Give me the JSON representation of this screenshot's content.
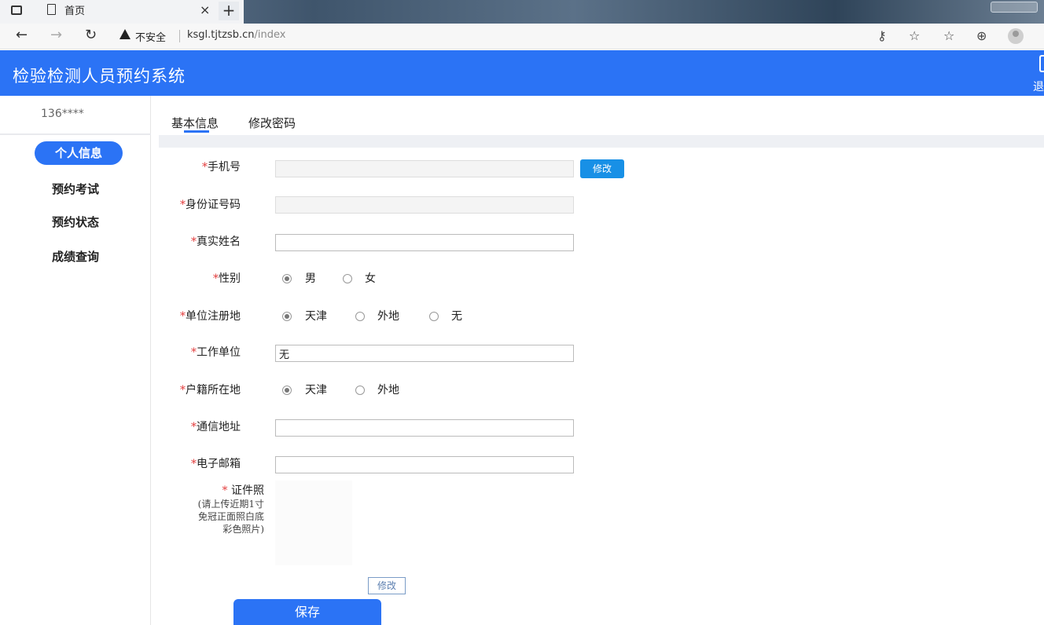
{
  "browser": {
    "tab_title": "首页",
    "tab_close": "×",
    "new_tab": "+",
    "insecure_label": "不安全",
    "url_host": "ksgl.tjtzsb.cn",
    "url_path": "/index"
  },
  "app": {
    "title": "检验检测人员预约系统",
    "header_edge_text": "退"
  },
  "sidebar": {
    "user": "136****",
    "items": [
      {
        "label": "个人信息",
        "active": true
      },
      {
        "label": "预约考试"
      },
      {
        "label": "预约状态"
      },
      {
        "label": "成绩查询"
      }
    ]
  },
  "tabs": [
    {
      "label": "基本信息",
      "active": true
    },
    {
      "label": "修改密码"
    }
  ],
  "form": {
    "required_mark": "*",
    "phone": {
      "label": "手机号",
      "value": "",
      "modify_button": "修改"
    },
    "id_number": {
      "label": "身份证号码",
      "value": ""
    },
    "real_name": {
      "label": "真实姓名",
      "value": ""
    },
    "gender": {
      "label": "性别",
      "options": [
        "男",
        "女"
      ],
      "selected": "男"
    },
    "unit_region": {
      "label": "单位注册地",
      "options": [
        "天津",
        "外地",
        "无"
      ],
      "selected": "天津"
    },
    "work_unit": {
      "label": "工作单位",
      "value": "无"
    },
    "household": {
      "label": "户籍所在地",
      "options": [
        "天津",
        "外地"
      ],
      "selected": "天津"
    },
    "address": {
      "label": "通信地址",
      "value": ""
    },
    "email": {
      "label": "电子邮箱",
      "value": ""
    },
    "photo": {
      "label": "证件照",
      "note_lines": [
        "(请上传近期1寸",
        "免冠正面照白底",
        "彩色照片)"
      ],
      "modify_button": "修改"
    },
    "save_button": "保存"
  }
}
